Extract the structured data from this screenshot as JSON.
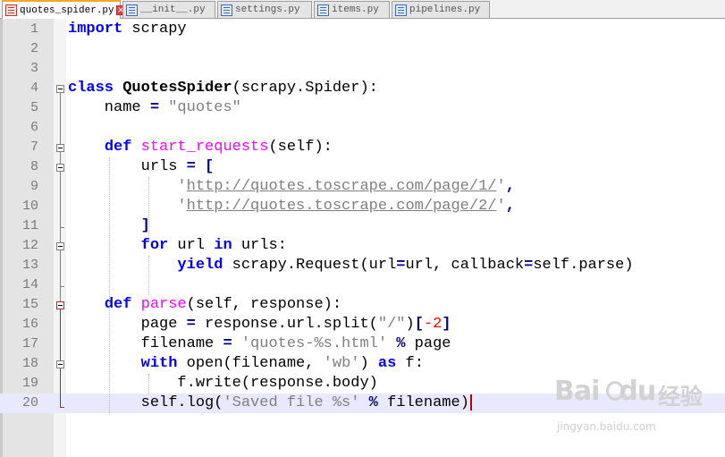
{
  "tabs": [
    {
      "label": "quotes_spider.py",
      "active": true
    },
    {
      "label": "__init__.py",
      "active": false
    },
    {
      "label": "settings.py",
      "active": false
    },
    {
      "label": "items.py",
      "active": false
    },
    {
      "label": "pipelines.py",
      "active": false
    }
  ],
  "line_numbers": [
    "1",
    "2",
    "3",
    "4",
    "5",
    "6",
    "7",
    "8",
    "9",
    "10",
    "11",
    "12",
    "13",
    "14",
    "15",
    "16",
    "17",
    "18",
    "19",
    "20"
  ],
  "code": {
    "l1": {
      "kw": "import",
      "rest": " scrapy"
    },
    "l4": {
      "kw": "class",
      "sp": " ",
      "name": "QuotesSpider",
      "rest": "(scrapy.Spider):"
    },
    "l5": {
      "pre": "    name ",
      "eq": "=",
      "sp": " ",
      "str": "\"quotes\""
    },
    "l7": {
      "pre": "    ",
      "kw": "def",
      "sp": " ",
      "fn": "start_requests",
      "rest": "(self):"
    },
    "l8": {
      "pre": "        urls ",
      "eq": "=",
      "sp": " ",
      "br": "["
    },
    "l9": {
      "pre": "            ",
      "q1": "'",
      "url": "http://quotes.toscrape.com/page/1/",
      "q2": "'",
      "comma": ","
    },
    "l10": {
      "pre": "            ",
      "q1": "'",
      "url": "http://quotes.toscrape.com/page/2/",
      "q2": "'",
      "comma": ","
    },
    "l11": {
      "pre": "        ",
      "br": "]"
    },
    "l12": {
      "pre": "        ",
      "kw": "for",
      "mid": " url ",
      "kw2": "in",
      "rest": " urls:"
    },
    "l13": {
      "pre": "            ",
      "kw": "yield",
      "rest": " scrapy.Request(url",
      "eq": "=",
      "rest2": "url, callback",
      "eq2": "=",
      "rest3": "self.parse)"
    },
    "l15": {
      "pre": "    ",
      "kw": "def",
      "sp": " ",
      "fn": "parse",
      "rest": "(self, response):"
    },
    "l16": {
      "pre": "        page ",
      "eq": "=",
      "rest": " response.url.split(",
      "str": "\"/\"",
      "rest2": ")",
      "ob": "[",
      "num": "-2",
      "cb": "]"
    },
    "l17": {
      "pre": "        filename ",
      "eq": "=",
      "sp": " ",
      "str": "'quotes-%s.html'",
      "sp2": " ",
      "pct": "%",
      "rest": " page"
    },
    "l18": {
      "pre": "        ",
      "kw": "with",
      "rest": " open(filename, ",
      "str": "'wb'",
      "rest2": ") ",
      "kw2": "as",
      "rest3": " f:"
    },
    "l19": {
      "pre": "            f.write(response.body)"
    },
    "l20": {
      "pre": "        self.log(",
      "str": "'Saved file %s'",
      "sp": " ",
      "pct": "%",
      "rest": " filename)"
    }
  },
  "current_line": 20,
  "watermark": {
    "logo": "Bai",
    "logo2": "du",
    "cn": "经验",
    "sub": "jingyan.baidu.com"
  },
  "colors": {
    "keyword": "#0000ff",
    "function": "#ff00ff",
    "string": "#808080",
    "operator": "#000080",
    "number": "#ff0000",
    "current_line_bg": "#e8e8ff",
    "active_tab_accent": "#f6a52b"
  }
}
